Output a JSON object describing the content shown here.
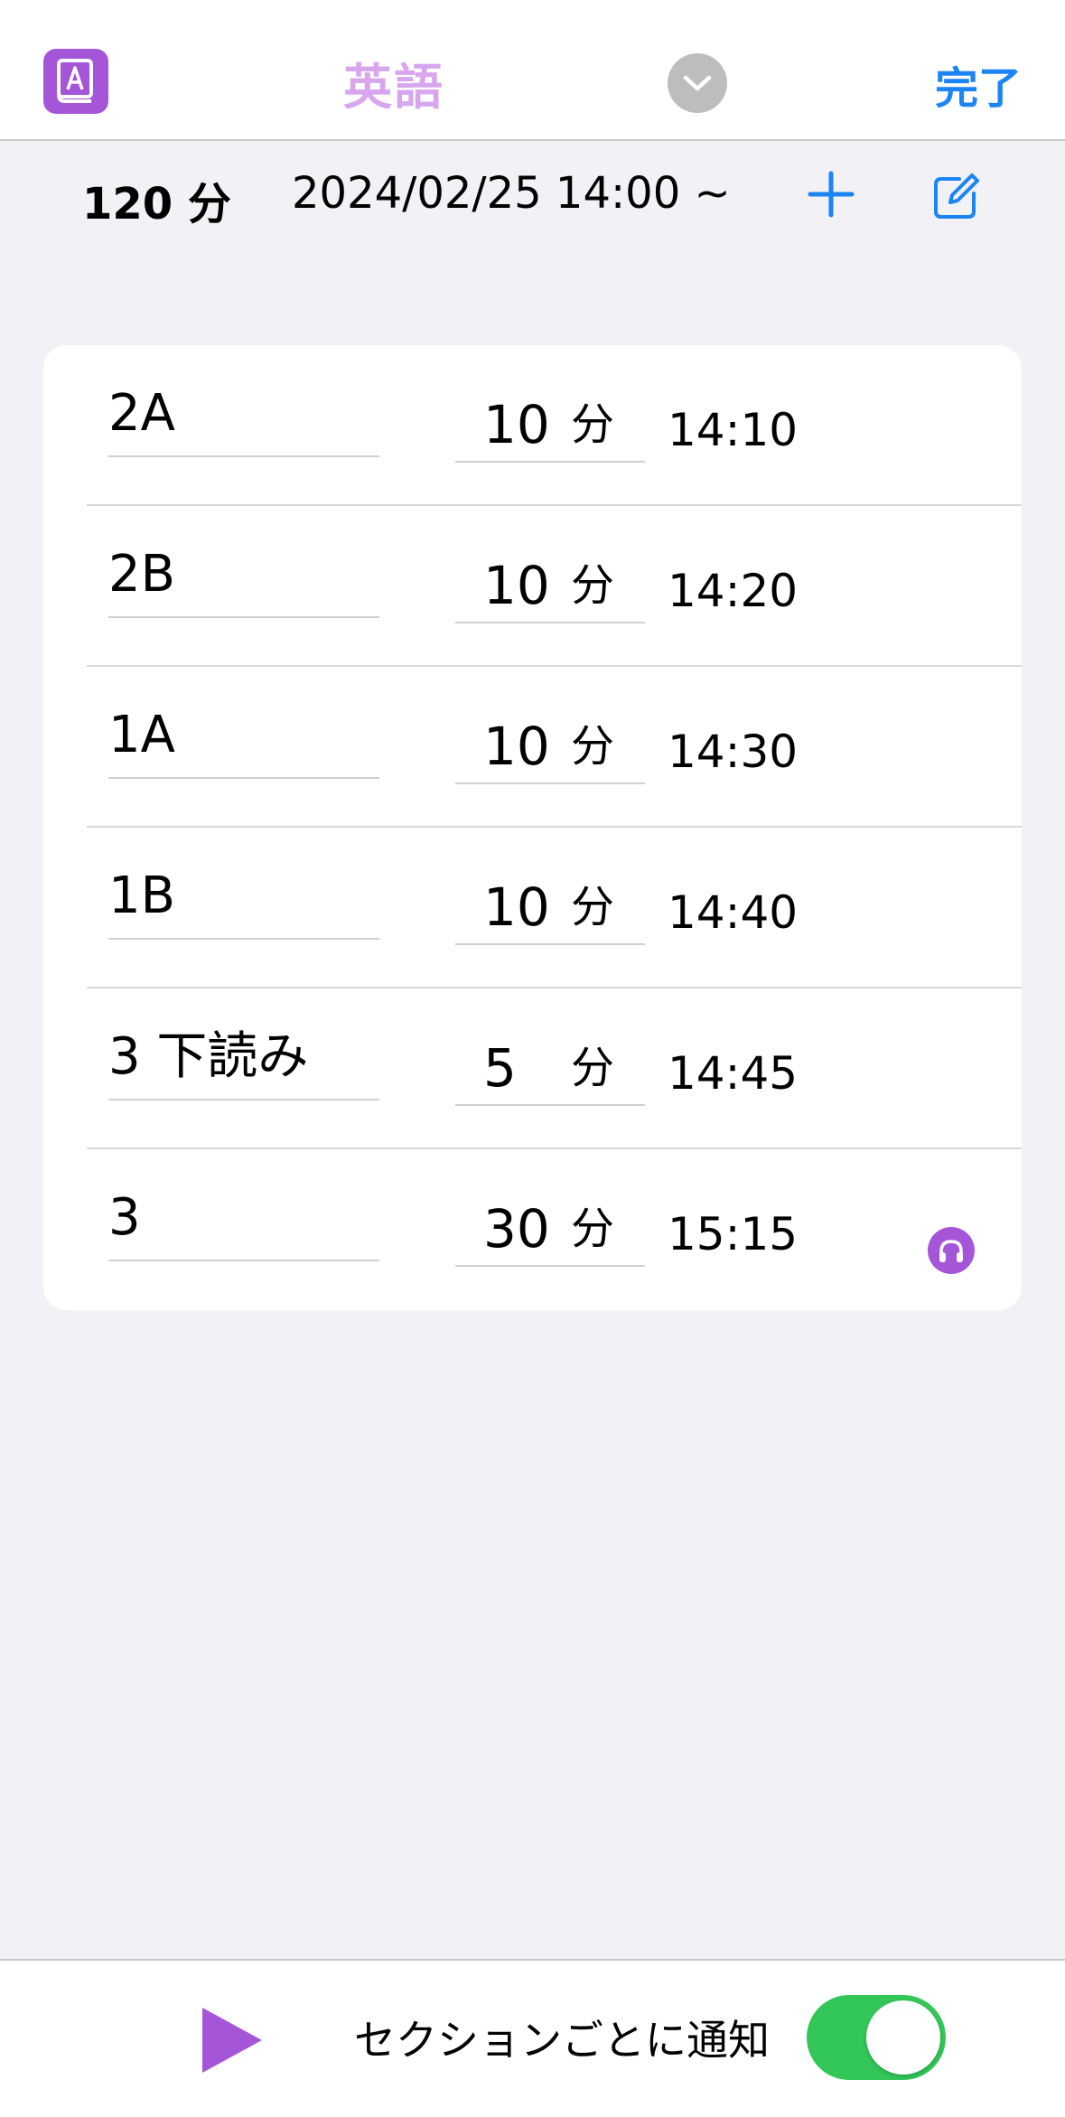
{
  "header": {
    "title": "英語",
    "done_label": "完了",
    "app_icon": "book-letter-a-icon",
    "title_icon": "chevron-down-icon",
    "accent": "#a556d8",
    "title_color": "#d7a6ef",
    "link_color": "#1d84f3"
  },
  "toolbar": {
    "total": "120 分",
    "start": "2024/02/25 14:00 ~",
    "add_icon": "plus-icon",
    "edit_icon": "square-pencil-icon"
  },
  "sections": [
    {
      "name": "2A",
      "minutes": "10",
      "unit": "分",
      "end_time": "14:10",
      "has_audio": false
    },
    {
      "name": "2B",
      "minutes": "10",
      "unit": "分",
      "end_time": "14:20",
      "has_audio": false
    },
    {
      "name": "1A",
      "minutes": "10",
      "unit": "分",
      "end_time": "14:30",
      "has_audio": false
    },
    {
      "name": "1B",
      "minutes": "10",
      "unit": "分",
      "end_time": "14:40",
      "has_audio": false
    },
    {
      "name": "3 下読み",
      "minutes": "5",
      "unit": "分",
      "end_time": "14:45",
      "has_audio": false
    },
    {
      "name": "3",
      "minutes": "30",
      "unit": "分",
      "end_time": "15:15",
      "has_audio": true
    }
  ],
  "bottom": {
    "play_icon": "play-icon",
    "notify_label": "セクションごとに通知",
    "notify_on": true,
    "toggle_color": "#33c659"
  }
}
